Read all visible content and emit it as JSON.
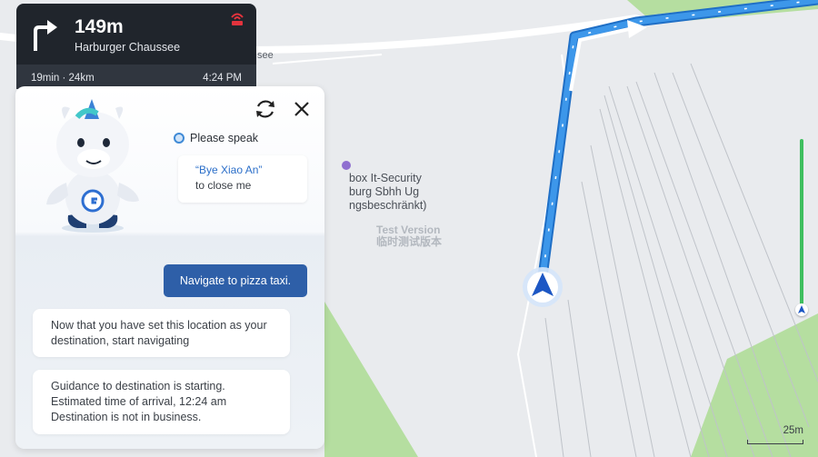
{
  "nav": {
    "distance": "149m",
    "street": "Harburger Chaussee",
    "duration_distance": "19min · 24km",
    "arrival_time": "4:24 PM",
    "turn_icon": "turn-right-arrow-icon",
    "gps_icon": "gps-signal-off-icon"
  },
  "map": {
    "street_fragment": "see",
    "poi_lines": [
      "box It-Security",
      "burg Sbhh Ug",
      "ngsbeschränkt)"
    ],
    "watermark_en": "Test Version",
    "watermark_cn": "临时测试版本",
    "scale_label": "25m",
    "route_color": "#2f8de4",
    "park_color": "#b5dea0"
  },
  "assistant": {
    "status": "Please speak",
    "hint_command": "“Bye Xiao An”",
    "hint_rest": "to close me",
    "user_message": "Navigate to pizza taxi.",
    "replies": [
      {
        "lines": [
          "Now that you have set this location as your",
          "destination, start navigating"
        ]
      },
      {
        "lines": [
          "Guidance to destination is starting.",
          "Estimated time of arrival, 12:24 am",
          "Destination is not in business."
        ]
      }
    ]
  }
}
